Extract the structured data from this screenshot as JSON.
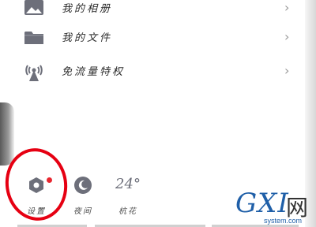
{
  "menu": {
    "items": [
      {
        "label": "我的相册",
        "icon": "photo-icon"
      },
      {
        "label": "我的文件",
        "icon": "folder-icon"
      },
      {
        "label": "免流量特权",
        "icon": "broadcast-tower-icon"
      }
    ],
    "chevron": "›"
  },
  "bottom_bar": {
    "settings_label": "设置",
    "night_label": "夜间",
    "weather_temp": "24°",
    "weather_label": "杭花"
  },
  "colors": {
    "annotation_red": "#e60012",
    "notification_dot": "#e8262f",
    "icon_gray": "#6d6f7a"
  },
  "watermark": {
    "big": "GXI",
    "cn": "网",
    "small": "system.com"
  }
}
